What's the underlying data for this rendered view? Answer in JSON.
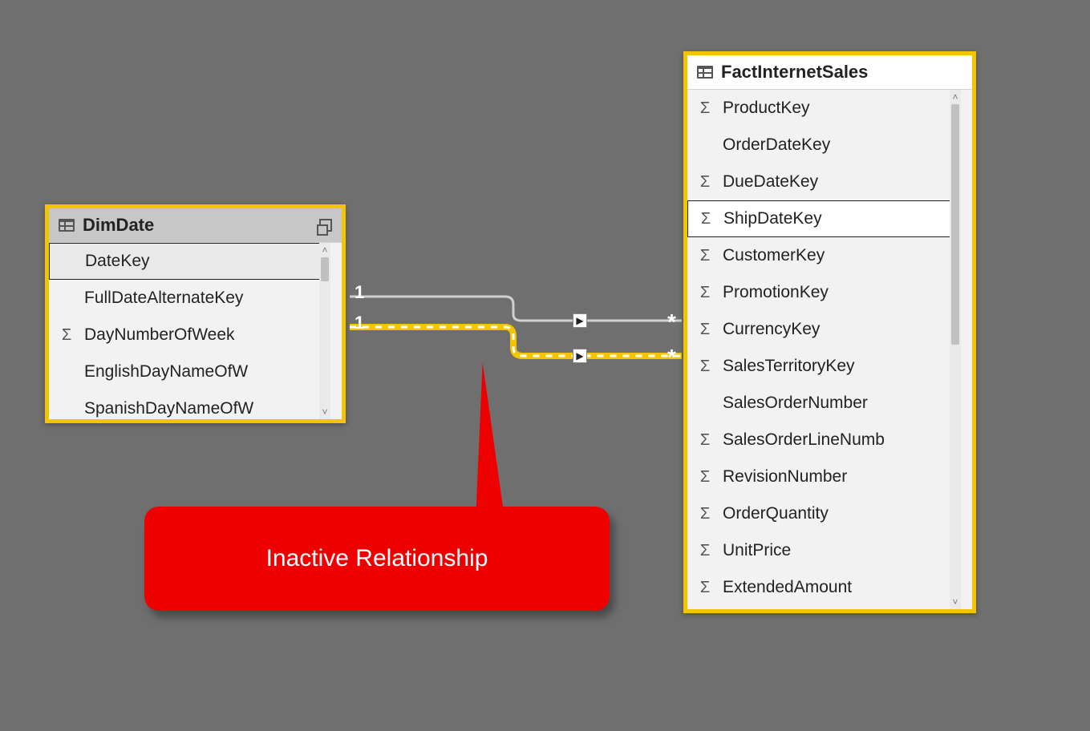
{
  "colors": {
    "accent": "#f3c500",
    "callout": "#ef0000"
  },
  "tables": {
    "dimdate": {
      "title": "DimDate",
      "fields": [
        {
          "name": "DateKey",
          "sigma": false,
          "selected": true
        },
        {
          "name": "FullDateAlternateKey",
          "sigma": false
        },
        {
          "name": "DayNumberOfWeek",
          "sigma": true
        },
        {
          "name": "EnglishDayNameOfW",
          "sigma": false
        },
        {
          "name": "SpanishDayNameOfW",
          "sigma": false
        }
      ]
    },
    "fact": {
      "title": "FactInternetSales",
      "fields": [
        {
          "name": "ProductKey",
          "sigma": true
        },
        {
          "name": "OrderDateKey",
          "sigma": false
        },
        {
          "name": "DueDateKey",
          "sigma": true
        },
        {
          "name": "ShipDateKey",
          "sigma": true,
          "selected": true
        },
        {
          "name": "CustomerKey",
          "sigma": true
        },
        {
          "name": "PromotionKey",
          "sigma": true
        },
        {
          "name": "CurrencyKey",
          "sigma": true
        },
        {
          "name": "SalesTerritoryKey",
          "sigma": true
        },
        {
          "name": "SalesOrderNumber",
          "sigma": false
        },
        {
          "name": "SalesOrderLineNumb",
          "sigma": true
        },
        {
          "name": "RevisionNumber",
          "sigma": true
        },
        {
          "name": "OrderQuantity",
          "sigma": true
        },
        {
          "name": "UnitPrice",
          "sigma": true
        },
        {
          "name": "ExtendedAmount",
          "sigma": true
        }
      ]
    }
  },
  "relationships": {
    "r1": {
      "left": "1",
      "right": "*",
      "state": "active"
    },
    "r2": {
      "left": "1",
      "right": "*",
      "state": "inactive"
    }
  },
  "callout": {
    "text": "Inactive Relationship"
  }
}
